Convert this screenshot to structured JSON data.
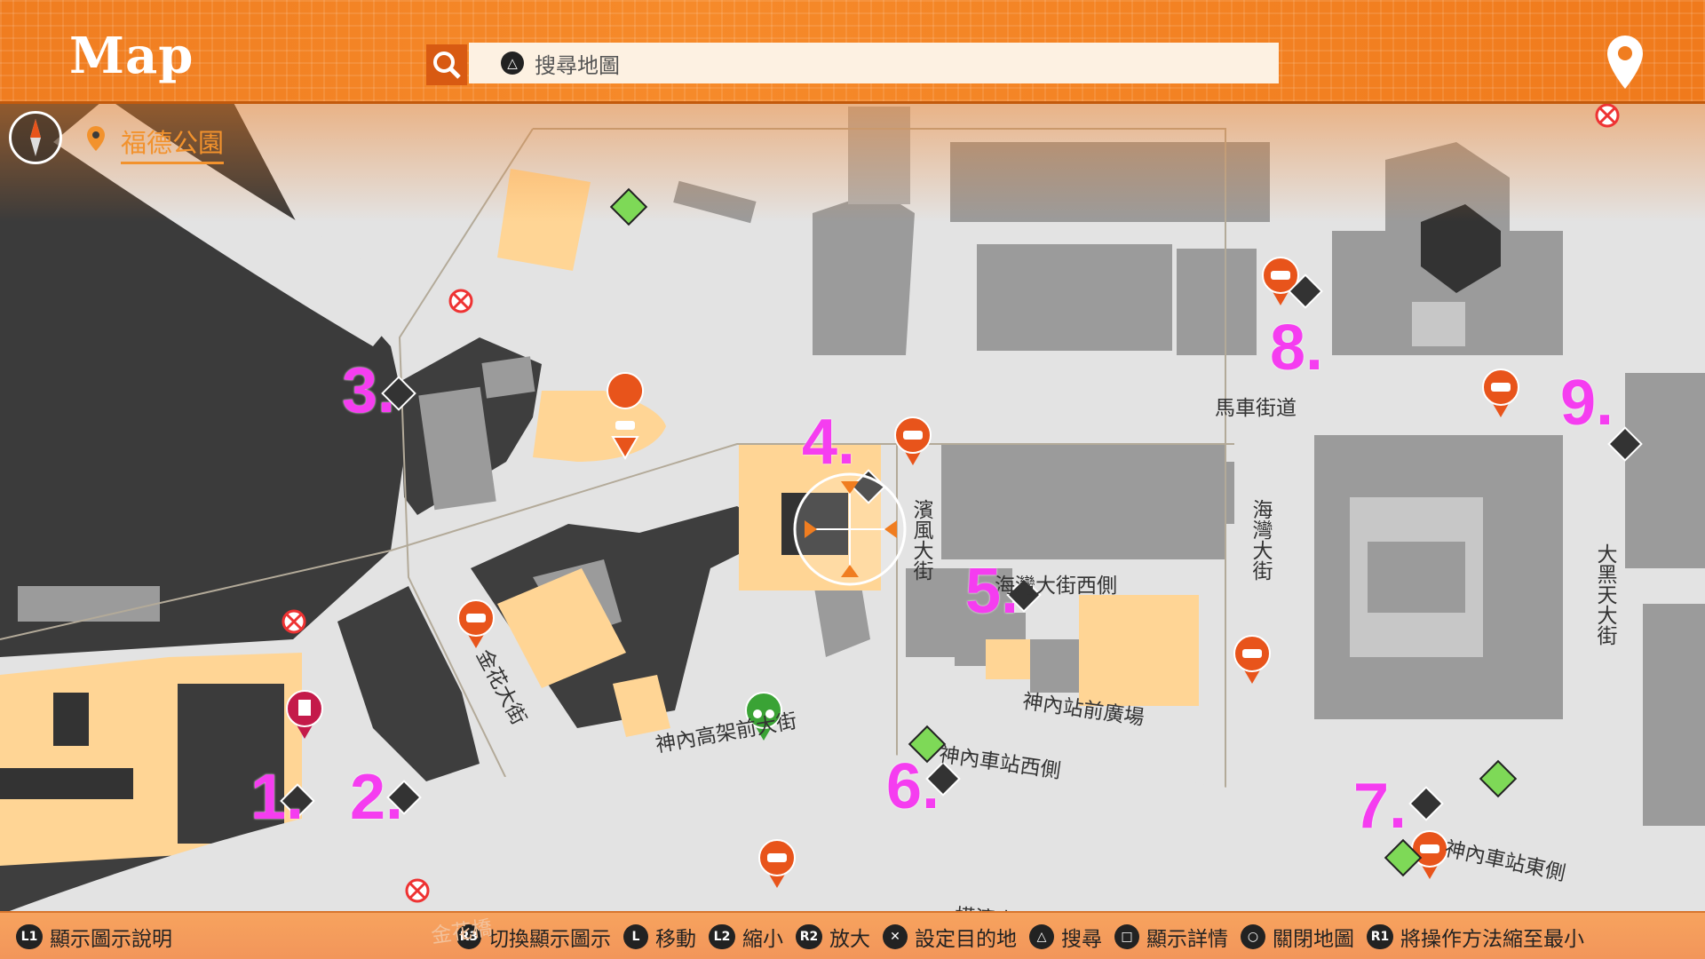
{
  "header": {
    "title": "Map",
    "search_placeholder": "搜尋地圖",
    "search_button_glyph": "△"
  },
  "location": {
    "name": "福德公園"
  },
  "numbers": [
    "1.",
    "2.",
    "3.",
    "4.",
    "5.",
    "6.",
    "7.",
    "8.",
    "9."
  ],
  "streets": {
    "jinhua": "金花大街",
    "kamuro_elevated": "神內高架前大街",
    "bayfront": "濱風大街",
    "bay_west": "海灣大街西側",
    "carriage": "馬車街道",
    "bay_street": "海灣大街",
    "daikoku": "大黑天大街",
    "station_plaza": "神內站前廣場",
    "station_west": "神內車站西側",
    "station_east": "神內車站東側",
    "yokohama": "橫濱大道",
    "jinhua_bridge": "金花橋"
  },
  "footer": [
    {
      "btn": "L1",
      "label": "顯示圖示說明"
    },
    {
      "btn": "R3",
      "label": "切換顯示圖示"
    },
    {
      "btn": "L",
      "label": "移動"
    },
    {
      "btn": "L2",
      "label": "縮小"
    },
    {
      "btn": "R2",
      "label": "放大"
    },
    {
      "btn": "✕",
      "label": "設定目的地"
    },
    {
      "btn": "△",
      "label": "搜尋"
    },
    {
      "btn": "□",
      "label": "顯示詳情"
    },
    {
      "btn": "○",
      "label": "關閉地圖"
    },
    {
      "btn": "R1",
      "label": "將操作方法縮至最小"
    }
  ],
  "colors": {
    "accent": "#f07d20",
    "highlight_building": "#ffd595",
    "road": "#e2e2e2",
    "building": "#9b9b9b",
    "number": "#f53df0",
    "taxi_pin": "#e8541b",
    "chat_marker": "#7ed957"
  },
  "icons": {
    "search": "search-icon",
    "pin": "map-pin-icon",
    "compass": "compass-icon",
    "taxi": "taxi-pin-icon",
    "chat": "chat-marker-icon",
    "check": "check-marker-icon",
    "blocked": "no-entry-icon",
    "motorbike": "motorbike-pin-icon",
    "building": "building-pin-icon"
  }
}
